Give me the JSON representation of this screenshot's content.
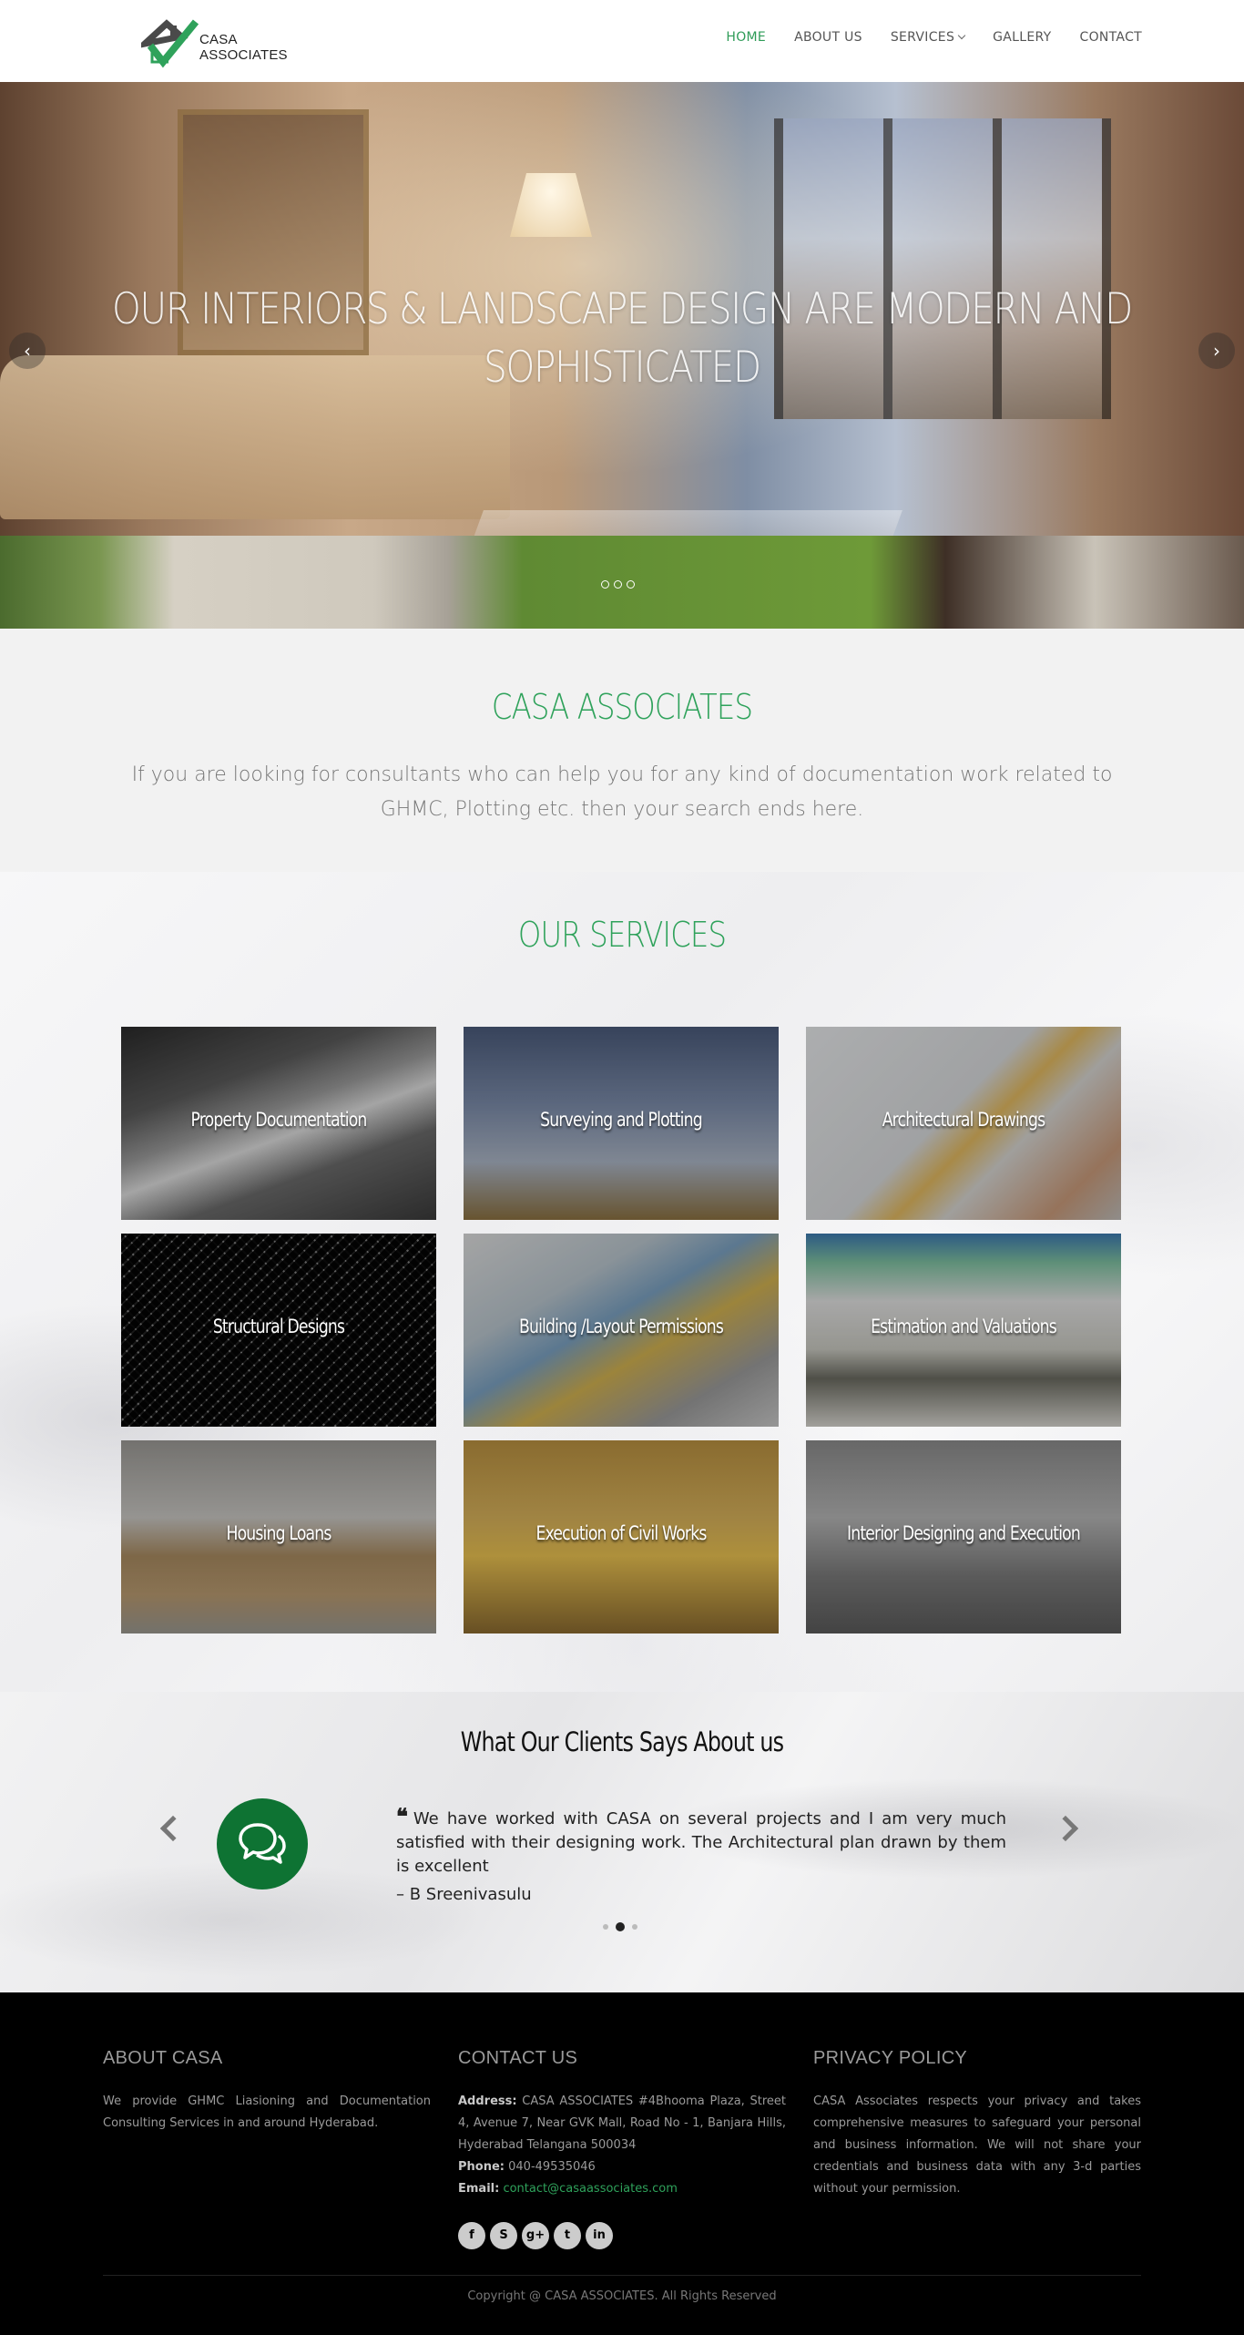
{
  "brand": {
    "name_line1": "CASA",
    "name_line2": "ASSOCIATES",
    "accent": "#2fa25b"
  },
  "nav": {
    "items": [
      {
        "label": "HOME",
        "active": true
      },
      {
        "label": "ABOUT US",
        "active": false
      },
      {
        "label": "SERVICES",
        "active": false,
        "has_dropdown": true
      },
      {
        "label": "GALLERY",
        "active": false
      },
      {
        "label": "CONTACT",
        "active": false
      }
    ]
  },
  "hero": {
    "title_line1": "OUR INTERIORS & LANDSCAPE DESIGN ARE MODERN AND",
    "title_line2": "SOPHISTICATED",
    "prev_icon": "chevron-left-icon",
    "next_icon": "chevron-right-icon",
    "prev_glyph": "‹",
    "next_glyph": "›",
    "slide_count": 3
  },
  "intro": {
    "title": "CASA ASSOCIATES",
    "text": "If you are looking for consultants who can help you for any kind of documentation work related to GHMC, Plotting etc. then your search ends here."
  },
  "services": {
    "title": "OUR SERVICES",
    "items": [
      {
        "label": "Property Documentation",
        "image": "stacked-files"
      },
      {
        "label": "Surveying and Plotting",
        "image": "crane-theodolite"
      },
      {
        "label": "Architectural Drawings",
        "image": "blueprint-helmet"
      },
      {
        "label": "Structural Designs",
        "image": "steel-dome"
      },
      {
        "label": "Building /Layout Permissions",
        "image": "blueprint-model"
      },
      {
        "label": "Estimation and Valuations",
        "image": "calculator-chart"
      },
      {
        "label": "Housing Loans",
        "image": "money-house-coins"
      },
      {
        "label": "Execution of Civil Works",
        "image": "helmet-construction"
      },
      {
        "label": "Interior Designing and Execution",
        "image": "living-room"
      }
    ]
  },
  "testimonials": {
    "title": "What Our Clients Says About us",
    "quote_glyph": "❝",
    "quote": "We have worked with CASA on several projects and I am very much satisfied with their designing work. The Architectural plan drawn by them is excellent",
    "author": "– B Sreenivasulu",
    "avatar_icon": "chat-bubbles-icon",
    "active_index": 1,
    "count": 3
  },
  "footer": {
    "about": {
      "title": "ABOUT CASA",
      "text": "We provide GHMC Liasioning and Documentation Consulting Services in and around Hyderabad."
    },
    "contact": {
      "title": "CONTACT US",
      "address_label": "Address:",
      "address": "CASA ASSOCIATES #4Bhooma Plaza, Street 4, Avenue 7, Near GVK Mall, Road No - 1, Banjara Hills, Hyderabad Telangana 500034",
      "phone_label": "Phone:",
      "phone": "040-49535046",
      "email_label": "Email:",
      "email": "contact@casaassociates.com",
      "social": [
        {
          "name": "facebook-icon",
          "glyph": "f"
        },
        {
          "name": "skype-icon",
          "glyph": "S"
        },
        {
          "name": "google-plus-icon",
          "glyph": "g+"
        },
        {
          "name": "twitter-icon",
          "glyph": "t"
        },
        {
          "name": "linkedin-icon",
          "glyph": "in"
        }
      ]
    },
    "privacy": {
      "title": "PRIVACY POLICY",
      "text": "CASA Associates respects your privacy and takes comprehensive measures to safeguard your personal and business information. We will not share your credentials and business data with any 3-d parties without your permission."
    },
    "copyright": "Copyright @ CASA ASSOCIATES. All Rights Reserved"
  }
}
